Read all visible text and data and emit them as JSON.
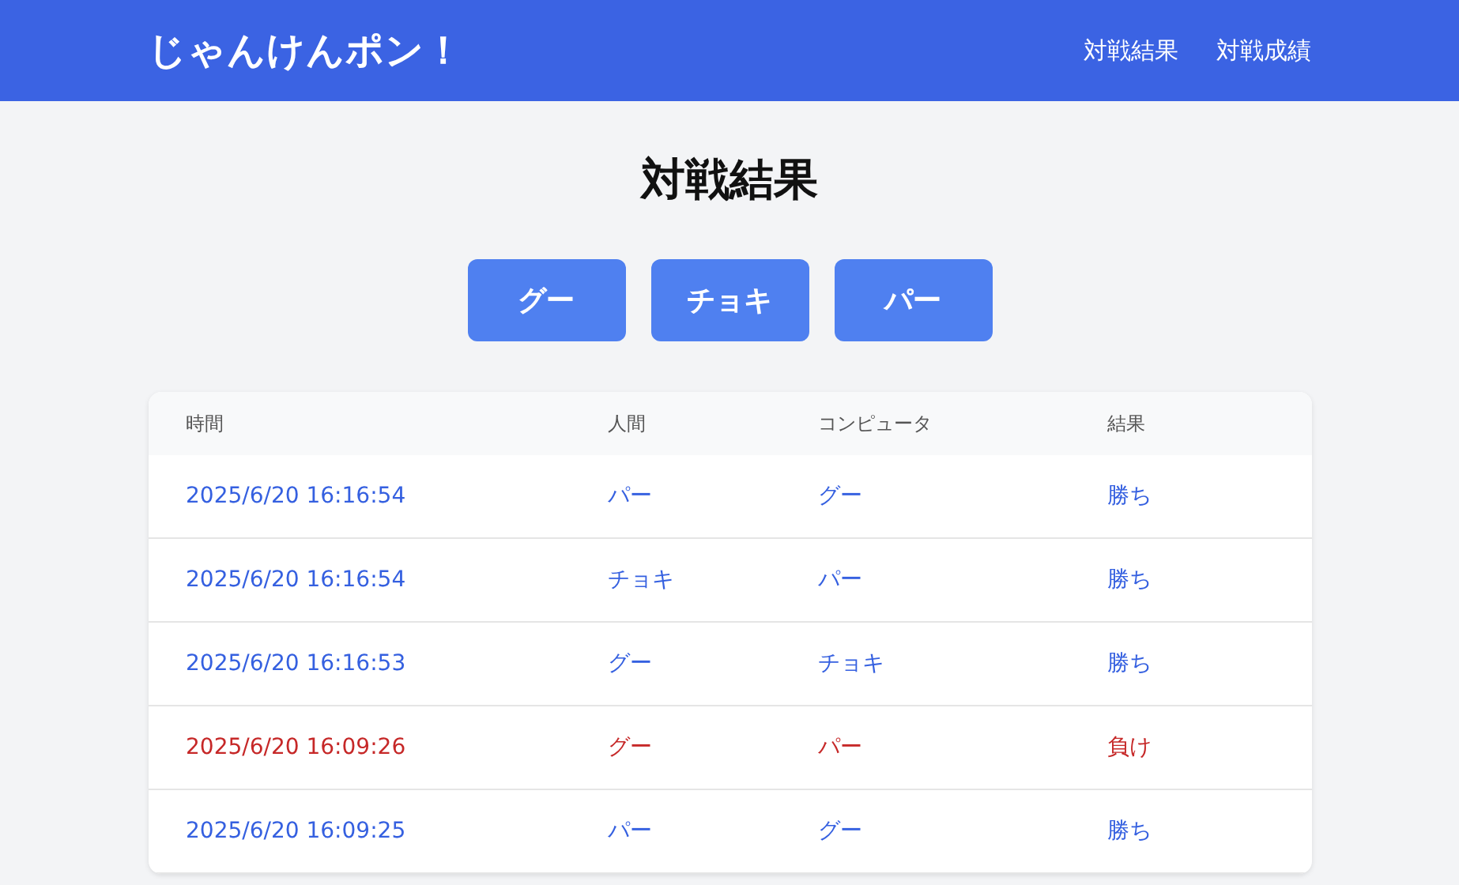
{
  "header": {
    "logo": "じゃんけんポン！",
    "nav": [
      {
        "label": "対戦結果"
      },
      {
        "label": "対戦成績"
      }
    ]
  },
  "page_title": "対戦結果",
  "hand_buttons": [
    "グー",
    "チョキ",
    "パー"
  ],
  "table": {
    "columns": [
      "時間",
      "人間",
      "コンピュータ",
      "結果"
    ],
    "rows": [
      {
        "kind": "win",
        "cells": [
          "2025/6/20 16:16:54",
          "パー",
          "グー",
          "勝ち"
        ]
      },
      {
        "kind": "win",
        "cells": [
          "2025/6/20 16:16:54",
          "チョキ",
          "パー",
          "勝ち"
        ]
      },
      {
        "kind": "win",
        "cells": [
          "2025/6/20 16:16:53",
          "グー",
          "チョキ",
          "勝ち"
        ]
      },
      {
        "kind": "lose",
        "cells": [
          "2025/6/20 16:09:26",
          "グー",
          "パー",
          "負け"
        ]
      },
      {
        "kind": "win",
        "cells": [
          "2025/6/20 16:09:25",
          "パー",
          "グー",
          "勝ち"
        ]
      }
    ]
  }
}
